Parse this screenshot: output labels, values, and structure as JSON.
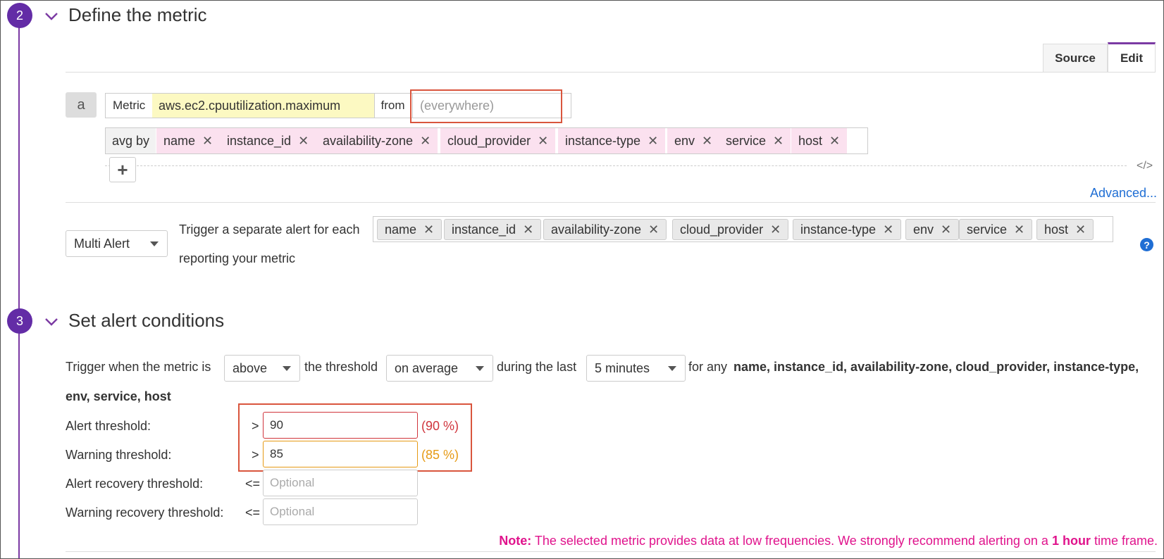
{
  "step2": {
    "number": "2",
    "title": "Define the metric"
  },
  "tabs": {
    "source": "Source",
    "edit": "Edit"
  },
  "query": {
    "letter": "a",
    "metric_label": "Metric",
    "metric_value": "aws.ec2.cpuutilization.maximum",
    "from_label": "from",
    "from_placeholder": "(everywhere)",
    "avg_by_label": "avg by",
    "group_by_tags": [
      "name",
      "instance_id",
      "availability-zone",
      "cloud_provider",
      "instance-type",
      "env",
      "service",
      "host"
    ],
    "add_button": "+",
    "code_toggle": "</>",
    "advanced_link": "Advanced..."
  },
  "multi_alert": {
    "select_value": "Multi Alert",
    "trigger_text": "Trigger a separate alert for each",
    "reporting_text": "reporting your metric",
    "tags": [
      "name",
      "instance_id",
      "availability-zone",
      "cloud_provider",
      "instance-type",
      "env",
      "service",
      "host"
    ],
    "help_icon": "?"
  },
  "step3": {
    "number": "3",
    "title": "Set alert conditions"
  },
  "conditions": {
    "trigger_prefix": "Trigger when the metric is",
    "comparison": "above",
    "threshold_text": "the threshold",
    "aggregation": "on average",
    "during_text": "during the last",
    "window": "5 minutes",
    "for_any": "for any",
    "group_list_line1": "name, instance_id, availability-zone, cloud_provider, instance-type,",
    "group_list_line2": "env, service, host"
  },
  "thresholds": {
    "alert_label": "Alert threshold:",
    "alert_op": ">",
    "alert_value": "90",
    "alert_pct": "(90 %)",
    "warning_label": "Warning threshold:",
    "warning_op": ">",
    "warning_value": "85",
    "warning_pct": "(85 %)",
    "alert_recovery_label": "Alert recovery threshold:",
    "alert_recovery_op": "<=",
    "alert_recovery_placeholder": "Optional",
    "warning_recovery_label": "Warning recovery threshold:",
    "warning_recovery_op": "<=",
    "warning_recovery_placeholder": "Optional"
  },
  "note": {
    "label": "Note:",
    "text_before": "The selected metric provides data at low frequencies. We strongly recommend alerting on a",
    "emphasis": "1 hour",
    "text_after": "time frame."
  },
  "colors": {
    "accent": "#632ca6",
    "link": "#1f6ed4",
    "alert": "#d0343c",
    "warning": "#e69a14",
    "note": "#e0138c",
    "highlight": "#d9553d"
  }
}
